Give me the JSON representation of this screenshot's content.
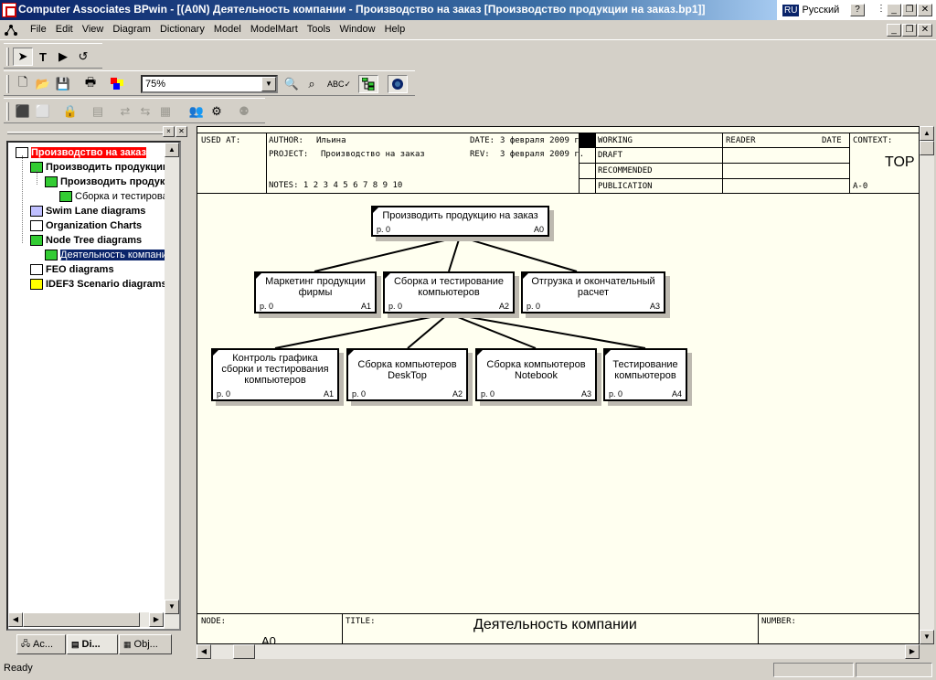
{
  "window": {
    "title": "Computer Associates BPwin - [(A0N) Деятельность компании - Производство на заказ  [Производство продукции на заказ.bp1]]",
    "lang_code": "RU",
    "lang_name": "Русский"
  },
  "menu": [
    "File",
    "Edit",
    "View",
    "Diagram",
    "Dictionary",
    "Model",
    "ModelMart",
    "Tools",
    "Window",
    "Help"
  ],
  "toolbar": {
    "zoom": "75%"
  },
  "tree": {
    "root": "Производство на заказ",
    "n1": "Производить продукцию на заказ",
    "n2": "Производить продукцию на заказ",
    "n3": "Сборка и тестирование компьютеров",
    "swim": "Swim Lane diagrams",
    "org": "Organization Charts",
    "nodetree": "Node Tree diagrams",
    "selected": "Деятельность компании",
    "feo": "FEO diagrams",
    "idef3": "IDEF3 Scenario diagrams"
  },
  "tabs": [
    "Ac...",
    "Di...",
    "Obj..."
  ],
  "diagram_header": {
    "used_at": "USED AT:",
    "author_label": "AUTHOR:",
    "author": "Ильина",
    "date_label": "DATE:",
    "date": "3 февраля 2009 г.",
    "project_label": "PROJECT:",
    "project": "Производство на заказ",
    "rev_label": "REV:",
    "rev": "3 февраля 2009 г.",
    "notes": "NOTES:  1  2  3  4  5  6  7  8  9  10",
    "working": "WORKING",
    "draft": "DRAFT",
    "recommended": "RECOMMENDED",
    "publication": "PUBLICATION",
    "reader": "READER",
    "date_col": "DATE",
    "context": "CONTEXT:",
    "top": "TOP",
    "a0": "A-0"
  },
  "nodes": {
    "root": {
      "text": "Производить продукцию на заказ",
      "page": "р. 0",
      "num": "A0"
    },
    "a1": {
      "text": "Маркетинг продукции\nфирмы",
      "page": "р. 0",
      "num": "A1"
    },
    "a2": {
      "text": "Сборка и тестирование\nкомпьютеров",
      "page": "р. 0",
      "num": "A2"
    },
    "a3": {
      "text": "Отгрузка и окончательный\nрасчет",
      "page": "р. 0",
      "num": "A3"
    },
    "b1": {
      "text": "Контроль графика\nсборки и тестирования\nкомпьютеров",
      "page": "р. 0",
      "num": "A1"
    },
    "b2": {
      "text": "Сборка компьютеров\nDeskTop",
      "page": "р. 0",
      "num": "A2"
    },
    "b3": {
      "text": "Сборка компьютеров\nNotebook",
      "page": "р. 0",
      "num": "A3"
    },
    "b4": {
      "text": "Тестирование\nкомпьютеров",
      "page": "р. 0",
      "num": "A4"
    }
  },
  "footer": {
    "node_label": "NODE:",
    "node": "A0",
    "title_label": "TITLE:",
    "title": "Деятельность компании",
    "number_label": "NUMBER:"
  },
  "status": {
    "text": "Ready"
  }
}
